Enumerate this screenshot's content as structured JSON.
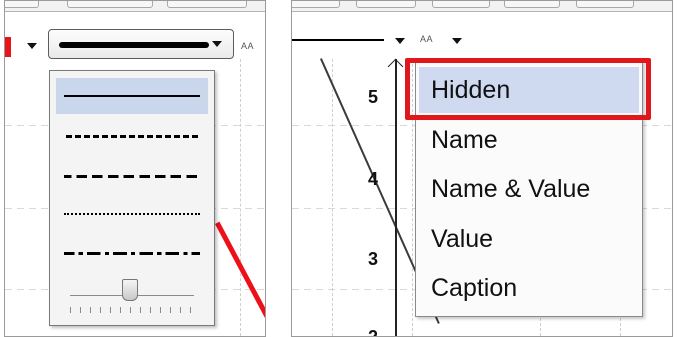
{
  "left": {
    "font_size_label": "AA",
    "line_styles": [
      {
        "name": "solid",
        "selected": true
      },
      {
        "name": "dashed-long",
        "selected": false
      },
      {
        "name": "dashed-short",
        "selected": false
      },
      {
        "name": "dotted",
        "selected": false
      },
      {
        "name": "dash-dot",
        "selected": false
      }
    ],
    "accent_color": "#e8141a"
  },
  "right": {
    "font_size_label": "AA",
    "axis_ticks": [
      "5",
      "4",
      "3",
      "2"
    ],
    "label_menu": {
      "items": [
        "Hidden",
        "Name",
        "Name & Value",
        "Value",
        "Caption"
      ],
      "selected": "Hidden"
    },
    "highlight_color": "#e2171c"
  }
}
